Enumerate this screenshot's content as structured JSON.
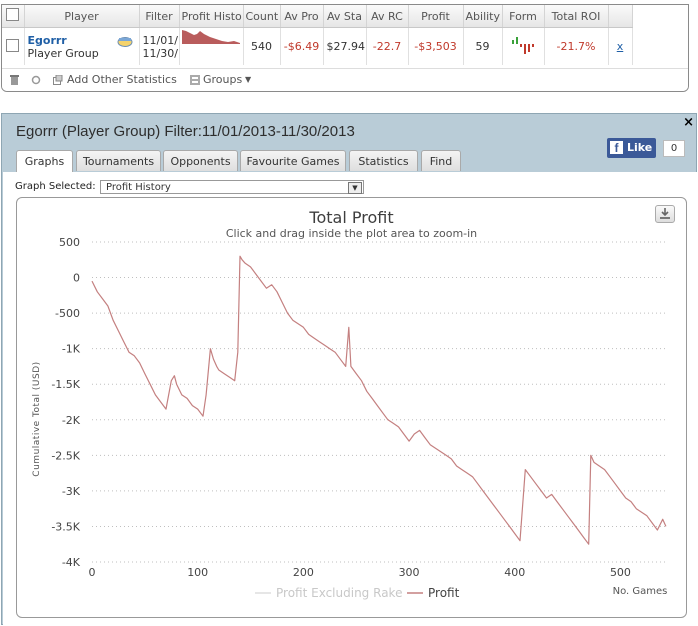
{
  "stats_table": {
    "columns": [
      "Player",
      "Filter",
      "Profit Histo",
      "Count",
      "Av Pro",
      "Av Sta",
      "Av RC",
      "Profit",
      "Ability",
      "Form",
      "Total ROI"
    ],
    "row": {
      "player_name": "Egorrr",
      "player_type": "Player Group",
      "filter_line1": "11/01/",
      "filter_line2": "11/30/",
      "count": "540",
      "av_profit": "-$6.49",
      "av_stake": "$27.94",
      "av_roi": "-22.7",
      "profit": "-$3,503",
      "ability": "59",
      "total_roi": "-21.7%",
      "remove": "x"
    },
    "toolbar": {
      "add_stats_label": "Add Other Statistics",
      "groups_label": "Groups"
    }
  },
  "panel": {
    "title": "Egorrr (Player Group) Filter:11/01/2013-11/30/2013",
    "close": "×",
    "tabs": [
      "Graphs",
      "Tournaments",
      "Opponents",
      "Favourite Games",
      "Statistics",
      "Find"
    ],
    "active_tab": "Graphs",
    "like": {
      "label": "Like",
      "count": "0"
    },
    "graph_selected_label": "Graph Selected:",
    "graph_selected_value": "Profit History"
  },
  "colors": {
    "profit_line": "#c48080",
    "excl_rake_line": "#dddddd",
    "panel_bg": "#b9ccd7",
    "negative_text": "#c0392b"
  },
  "chart_data": {
    "type": "line",
    "title": "Total Profit",
    "subtitle": "Click and drag inside the plot area to zoom-in",
    "ylabel": "Cumulative Total (USD)",
    "xlabel": "No. Games",
    "xlim": [
      0,
      545
    ],
    "ylim": [
      -4000,
      500
    ],
    "xticks": [
      0,
      100,
      200,
      300,
      400,
      500
    ],
    "yticks": [
      500,
      0,
      -500,
      -1000,
      -1500,
      -2000,
      -2500,
      -3000,
      -3500,
      -4000
    ],
    "ytick_labels": [
      "500",
      "0",
      "-500",
      "-1K",
      "-1.5K",
      "-2K",
      "-2.5K",
      "-3K",
      "-3.5K",
      "-4K"
    ],
    "grid": "horizontal-dotted",
    "legend": "bottom-center",
    "series": [
      {
        "name": "Profit Excluding Rake",
        "values": []
      },
      {
        "name": "Profit",
        "x": [
          0,
          5,
          10,
          15,
          20,
          25,
          30,
          35,
          40,
          45,
          50,
          55,
          60,
          65,
          70,
          75,
          78,
          80,
          85,
          90,
          95,
          100,
          105,
          108,
          112,
          115,
          118,
          120,
          125,
          130,
          135,
          138,
          140,
          142,
          145,
          150,
          155,
          160,
          165,
          170,
          175,
          180,
          185,
          190,
          195,
          200,
          205,
          210,
          215,
          220,
          225,
          230,
          235,
          240,
          243,
          245,
          250,
          255,
          260,
          265,
          270,
          275,
          280,
          285,
          290,
          295,
          300,
          305,
          310,
          315,
          320,
          325,
          330,
          335,
          340,
          345,
          350,
          355,
          360,
          365,
          370,
          375,
          380,
          385,
          390,
          395,
          400,
          405,
          410,
          415,
          420,
          425,
          430,
          435,
          440,
          445,
          450,
          455,
          460,
          465,
          470,
          472,
          475,
          480,
          485,
          490,
          495,
          500,
          505,
          510,
          515,
          520,
          525,
          530,
          535,
          540,
          543
        ],
        "values": [
          -50,
          -200,
          -300,
          -400,
          -600,
          -750,
          -900,
          -1050,
          -1100,
          -1200,
          -1350,
          -1500,
          -1650,
          -1750,
          -1850,
          -1450,
          -1380,
          -1500,
          -1650,
          -1700,
          -1800,
          -1850,
          -1950,
          -1650,
          -1000,
          -1150,
          -1250,
          -1300,
          -1350,
          -1400,
          -1450,
          -1050,
          300,
          250,
          200,
          150,
          50,
          -50,
          -150,
          -100,
          -200,
          -350,
          -500,
          -600,
          -650,
          -700,
          -800,
          -850,
          -900,
          -950,
          -1000,
          -1050,
          -1150,
          -1250,
          -700,
          -1250,
          -1350,
          -1450,
          -1600,
          -1700,
          -1800,
          -1900,
          -2000,
          -2050,
          -2100,
          -2200,
          -2300,
          -2200,
          -2150,
          -2250,
          -2350,
          -2400,
          -2450,
          -2500,
          -2550,
          -2650,
          -2700,
          -2750,
          -2800,
          -2900,
          -3000,
          -3100,
          -3200,
          -3300,
          -3400,
          -3500,
          -3600,
          -3700,
          -2700,
          -2800,
          -2900,
          -3000,
          -3100,
          -3050,
          -3150,
          -3250,
          -3350,
          -3450,
          -3550,
          -3650,
          -3750,
          -2500,
          -2600,
          -2650,
          -2700,
          -2800,
          -2900,
          -3000,
          -3100,
          -3150,
          -3250,
          -3300,
          -3350,
          -3450,
          -3550,
          -3400,
          -3500
        ]
      }
    ]
  }
}
